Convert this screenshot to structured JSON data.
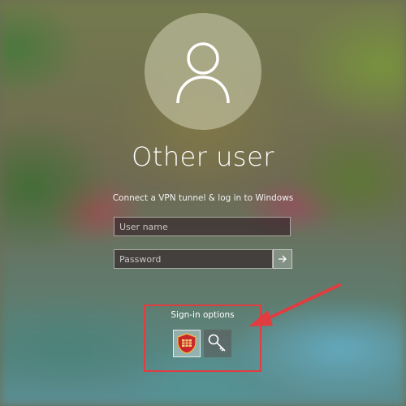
{
  "screen": {
    "title": "Other user",
    "subtitle": "Connect a VPN tunnel & log in to Windows"
  },
  "form": {
    "username_placeholder": "User name",
    "password_placeholder": "Password",
    "submit_icon": "arrow-right-icon"
  },
  "signin_options": {
    "label": "Sign-in options",
    "options": [
      {
        "icon": "vpn-shield-icon"
      },
      {
        "icon": "key-icon"
      }
    ]
  },
  "annotation": {
    "highlight_color": "#e03d40",
    "arrow_color": "#e03d40"
  }
}
